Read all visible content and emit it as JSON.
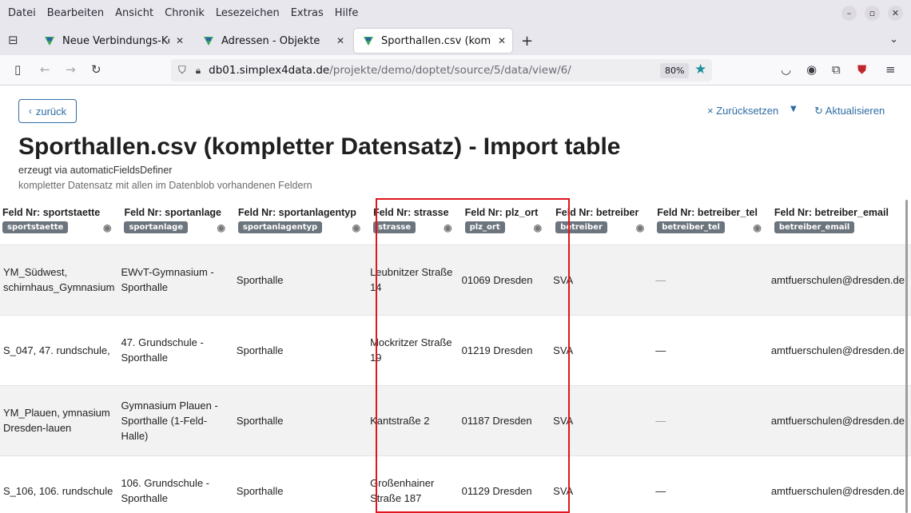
{
  "menubar": {
    "items": [
      "Datei",
      "Bearbeiten",
      "Ansicht",
      "Chronik",
      "Lesezeichen",
      "Extras",
      "Hilfe"
    ]
  },
  "tabs": [
    {
      "label": "Neue Verbindungs-Konve"
    },
    {
      "label": "Adressen - Objekte"
    },
    {
      "label": "Sporthallen.csv (komplett"
    }
  ],
  "urlbar": {
    "host": "db01.simplex4data.de",
    "path": "/projekte/demo/doptet/source/5/data/view/6/",
    "zoom": "80%"
  },
  "page": {
    "back_label": "zurück",
    "reset_label": "Zurücksetzen",
    "refresh_label": "Aktualisieren",
    "title": "Sporthallen.csv (kompletter Datensatz) - Import table",
    "subtitle1": "erzeugt via automaticFieldsDefiner",
    "subtitle2": "kompletter Datensatz mit allen im Datenblob vorhandenen Feldern"
  },
  "table": {
    "columns": [
      {
        "header": "Feld Nr: sportstaette",
        "badge": "sportstaette"
      },
      {
        "header": "Feld Nr: sportanlage",
        "badge": "sportanlage"
      },
      {
        "header": "Feld Nr: sportanlagentyp",
        "badge": "sportanlagentyp"
      },
      {
        "header": "Feld Nr: strasse",
        "badge": "strasse"
      },
      {
        "header": "Feld Nr: plz_ort",
        "badge": "plz_ort"
      },
      {
        "header": "Feld Nr: betreiber",
        "badge": "betreiber"
      },
      {
        "header": "Feld Nr: betreiber_tel",
        "badge": "betreiber_tel"
      },
      {
        "header": "Feld Nr: betreiber_email",
        "badge": "betreiber_email"
      }
    ],
    "rows": [
      [
        "YM_Südwest, schirnhaus_Gymnasium",
        "EWvT-Gymnasium - Sporthalle",
        "Sporthalle",
        "Leubnitzer Straße 14",
        "01069 Dresden",
        "SVA",
        "—",
        "amtfuerschulen@dresden.de"
      ],
      [
        "S_047, 47. rundschule,",
        "47. Grundschule - Sporthalle",
        "Sporthalle",
        "Mockritzer Straße 19",
        "01219 Dresden",
        "SVA",
        "—",
        "amtfuerschulen@dresden.de"
      ],
      [
        "YM_Plauen, ymnasium Dresden-lauen",
        "Gymnasium Plauen - Sporthalle (1-Feld-Halle)",
        "Sporthalle",
        "Kantstraße 2",
        "01187 Dresden",
        "SVA",
        "—",
        "amtfuerschulen@dresden.de"
      ],
      [
        "S_106, 106. rundschule",
        "106. Grundschule - Sporthalle",
        "Sporthalle",
        "Großenhainer Straße 187",
        "01129 Dresden",
        "SVA",
        "—",
        "amtfuerschulen@dresden.de"
      ]
    ]
  },
  "colors": {
    "link": "#2e6ca4",
    "highlight": "#e0151d",
    "badge": "#6c757d",
    "star": "#1d8f9e"
  }
}
